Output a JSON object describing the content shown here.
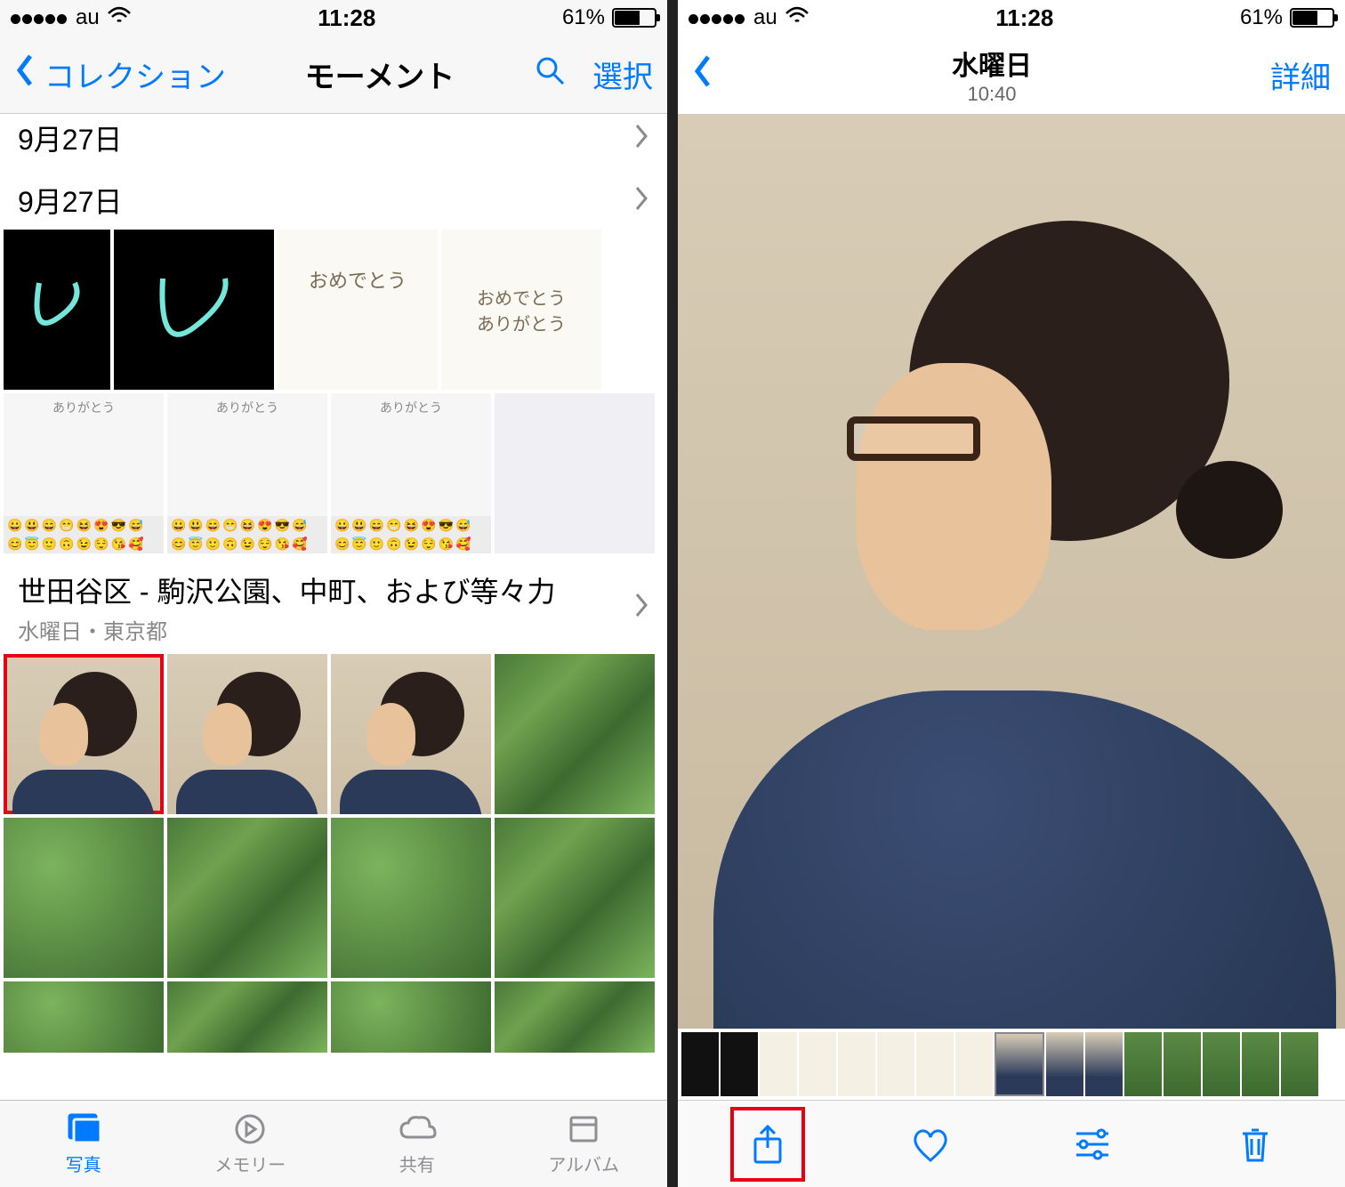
{
  "status": {
    "carrier": "au",
    "time": "11:28",
    "battery_pct": "61%"
  },
  "left": {
    "nav": {
      "back": "コレクション",
      "title": "モーメント",
      "select": "選択"
    },
    "sections": [
      {
        "title": "9月27日"
      },
      {
        "title": "9月27日"
      },
      {
        "title": "世田谷区 - 駒沢公園、中町、および等々力",
        "subtitle": "水曜日・東京都"
      }
    ],
    "thumbtext": {
      "omedeto": "おめでとう",
      "omedeto_arigato": "おめでとう\nありがとう",
      "arigato": "ありがとう"
    },
    "tabs": {
      "photos": "写真",
      "memories": "メモリー",
      "shared": "共有",
      "albums": "アルバム"
    }
  },
  "right": {
    "nav": {
      "title": "水曜日",
      "subtitle": "10:40",
      "details": "詳細"
    }
  }
}
